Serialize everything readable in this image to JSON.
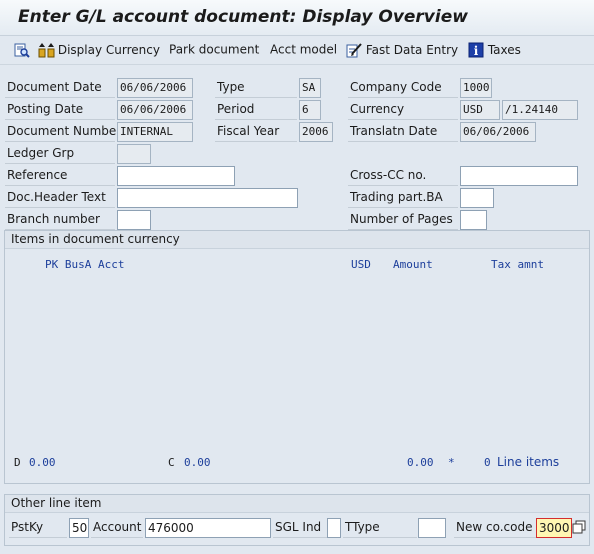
{
  "title": "Enter G/L account document: Display Overview",
  "toolbar": {
    "display_currency": "Display Currency",
    "park_document": "Park document",
    "acct_model": "Acct model",
    "fast_data_entry": "Fast Data Entry",
    "taxes": "Taxes",
    "icons": [
      "document-search-icon",
      "display-currency-icon",
      "fast-data-entry-icon",
      "info-taxes-icon"
    ]
  },
  "header": {
    "document_date_label": "Document Date",
    "document_date": "06/06/2006",
    "type_label": "Type",
    "type": "SA",
    "company_code_label": "Company Code",
    "company_code": "1000",
    "posting_date_label": "Posting Date",
    "posting_date": "06/06/2006",
    "period_label": "Period",
    "period": "6",
    "currency_label": "Currency",
    "currency": "USD",
    "exchange_rate": "/1.24140",
    "document_number_label": "Document Number",
    "document_number": "INTERNAL",
    "fiscal_year_label": "Fiscal Year",
    "fiscal_year": "2006",
    "translatn_date_label": "Translatn Date",
    "translatn_date": "06/06/2006",
    "ledger_grp_label": "Ledger Grp",
    "ledger_grp": "",
    "reference_label": "Reference",
    "reference": "",
    "cross_cc_label": "Cross-CC no.",
    "cross_cc": "",
    "doc_header_text_label": "Doc.Header Text",
    "doc_header_text": "",
    "trading_part_label": "Trading part.BA",
    "trading_part": "",
    "branch_number_label": "Branch number",
    "branch_number": "",
    "number_of_pages_label": "Number of Pages",
    "number_of_pages": ""
  },
  "items": {
    "group_title": "Items in document currency",
    "columns": {
      "pk_busa_acct": "PK  BusA Acct",
      "currency": "USD",
      "amount": "Amount",
      "tax_amnt": "Tax amnt"
    },
    "footer": {
      "debit_label": "D",
      "debit_value": "0.00",
      "credit_label": "C",
      "credit_value": "0.00",
      "balance_value": "0.00",
      "balance_flag": "*",
      "line_items_count": "0",
      "line_items_label": "Line items"
    }
  },
  "other_line_item": {
    "group_title": "Other line item",
    "pstky_label": "PstKy",
    "pstky": "50",
    "account_label": "Account",
    "account": "476000",
    "sgl_ind_label": "SGL Ind",
    "sgl_ind": "",
    "ttype_label": "TType",
    "ttype": "",
    "new_co_code_label": "New co.code",
    "new_co_code": "3000"
  },
  "colors": {
    "background": "#e1e8f0",
    "link_blue": "#1d3f9b",
    "highlight_yellow": "#fff7b3",
    "focus_red": "#d42d2d"
  }
}
